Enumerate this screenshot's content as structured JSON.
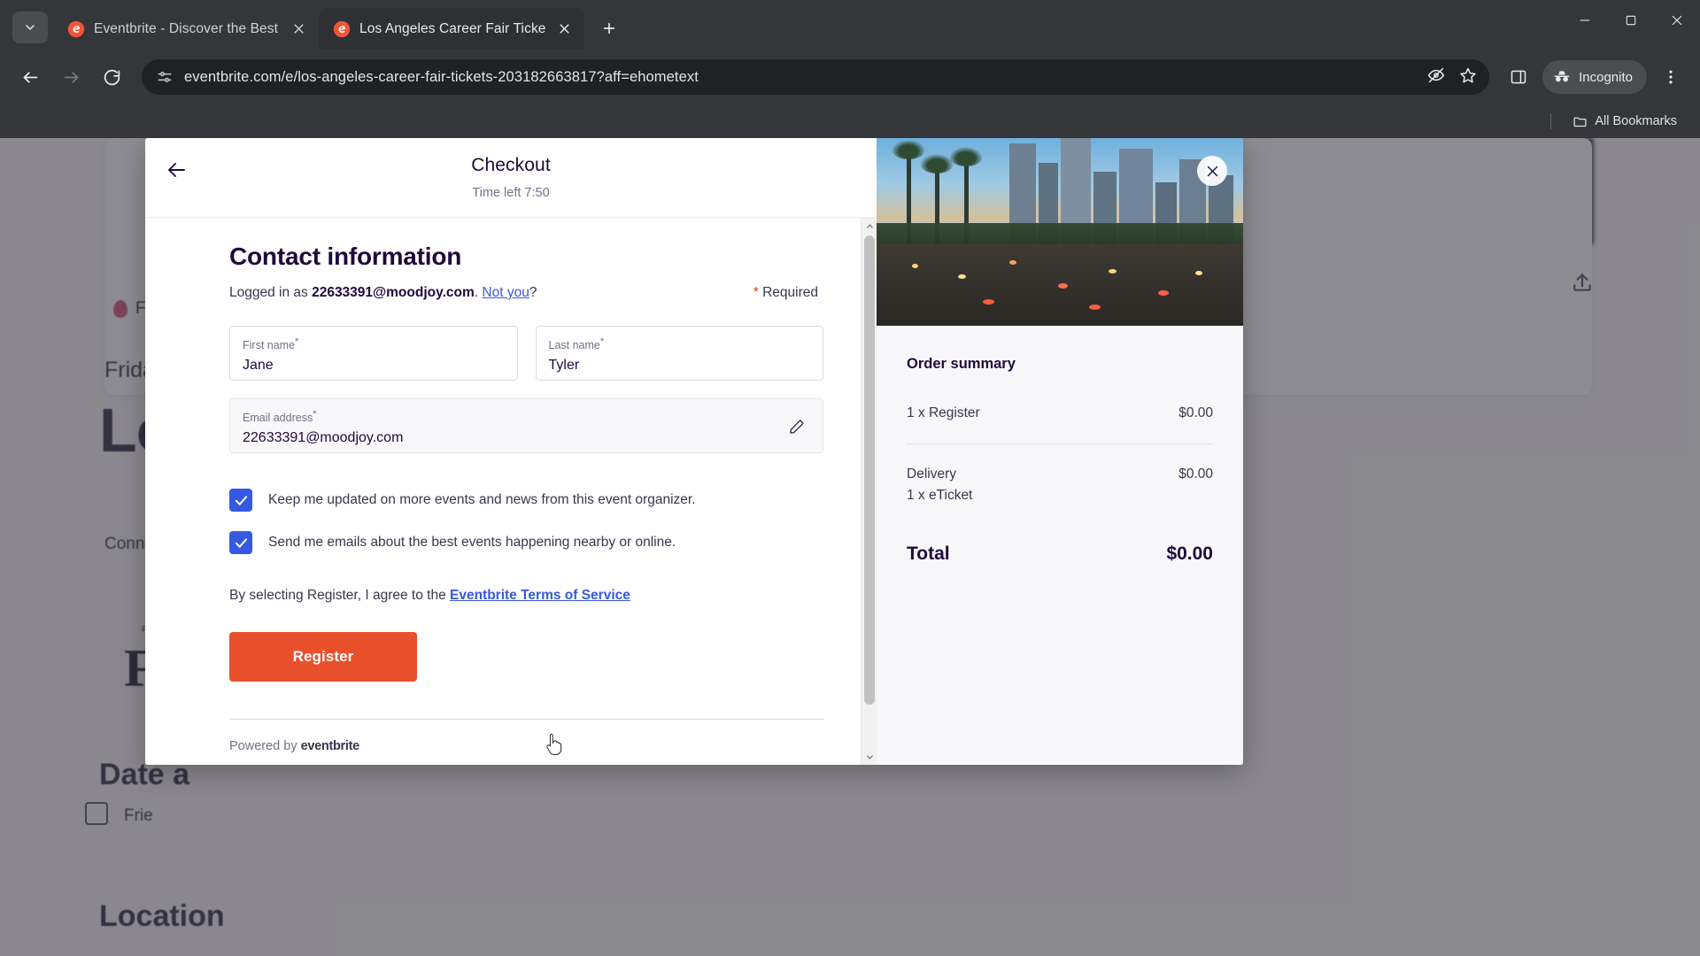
{
  "browser": {
    "tabs": [
      {
        "title": "Eventbrite - Discover the Best L",
        "favicon": "eventbrite-icon",
        "active": false
      },
      {
        "title": "Los Angeles Career Fair Tickets",
        "favicon": "eventbrite-icon",
        "active": true
      }
    ],
    "new_tab_label": "+",
    "url": "eventbrite.com/e/los-angeles-career-fair-tickets-203182663817?aff=ehometext",
    "profile_label": "Incognito",
    "bookmarks_label": "All Bookmarks",
    "icons": {
      "tab_search": "chevron-down-icon",
      "back": "back-arrow-icon",
      "forward": "forward-arrow-icon",
      "reload": "reload-icon",
      "site_info": "page-info-icon",
      "tracking": "eye-off-icon",
      "bookmark": "star-icon",
      "side_panel": "side-panel-icon",
      "incognito": "incognito-icon",
      "menu": "three-dot-menu-icon",
      "minimize": "minimize-icon",
      "maximize": "maximize-icon",
      "close_window": "window-close-icon",
      "folder": "folder-icon"
    }
  },
  "background_page": {
    "badge": "Few",
    "date_line": "Friday,",
    "event_title": "Los",
    "connect_line": "Connect",
    "fair_code": "FAIR CO",
    "serif_letter": "F",
    "date_and_heading": "Date a",
    "date_value": "Frie",
    "location_heading": "Location"
  },
  "checkout": {
    "title": "Checkout",
    "timer": "Time left 7:50",
    "back_icon": "back-arrow-icon",
    "section_title": "Contact information",
    "logged_in_prefix": "Logged in as ",
    "logged_in_email": "22633391@moodjoy.com",
    "logged_in_suffix": ".",
    "not_you_link": "Not you",
    "not_you_suffix": "?",
    "required_asterisk": "*",
    "required_label": " Required",
    "fields": {
      "first_name": {
        "label": "First name",
        "required_mark": "*",
        "value": "Jane"
      },
      "last_name": {
        "label": "Last name",
        "required_mark": "*",
        "value": "Tyler"
      },
      "email": {
        "label": "Email address",
        "required_mark": "*",
        "value": "22633391@moodjoy.com",
        "edit_icon": "pencil-icon"
      }
    },
    "checkboxes": [
      {
        "label": "Keep me updated on more events and news from this event organizer.",
        "checked": true
      },
      {
        "label": "Send me emails about the best events happening nearby or online.",
        "checked": true
      }
    ],
    "terms_prefix": "By selecting Register, I agree to the ",
    "terms_link": "Eventbrite Terms of Service",
    "register_button": "Register",
    "powered_by_prefix": "Powered by ",
    "powered_by_brand": "eventbrite",
    "close_icon": "close-icon"
  },
  "order_summary": {
    "title": "Order summary",
    "items": [
      {
        "name": "1 x Register",
        "sub": "",
        "price": "$0.00"
      },
      {
        "name": "Delivery",
        "sub": "1 x eTicket",
        "price": "$0.00"
      }
    ],
    "total_label": "Total",
    "total_value": "$0.00"
  },
  "colors": {
    "accent_orange": "#e8502c",
    "link_blue": "#3659e3",
    "checkbox_blue": "#3659e3",
    "text_dark": "#1e0a3c",
    "text_muted": "#6f7287"
  }
}
